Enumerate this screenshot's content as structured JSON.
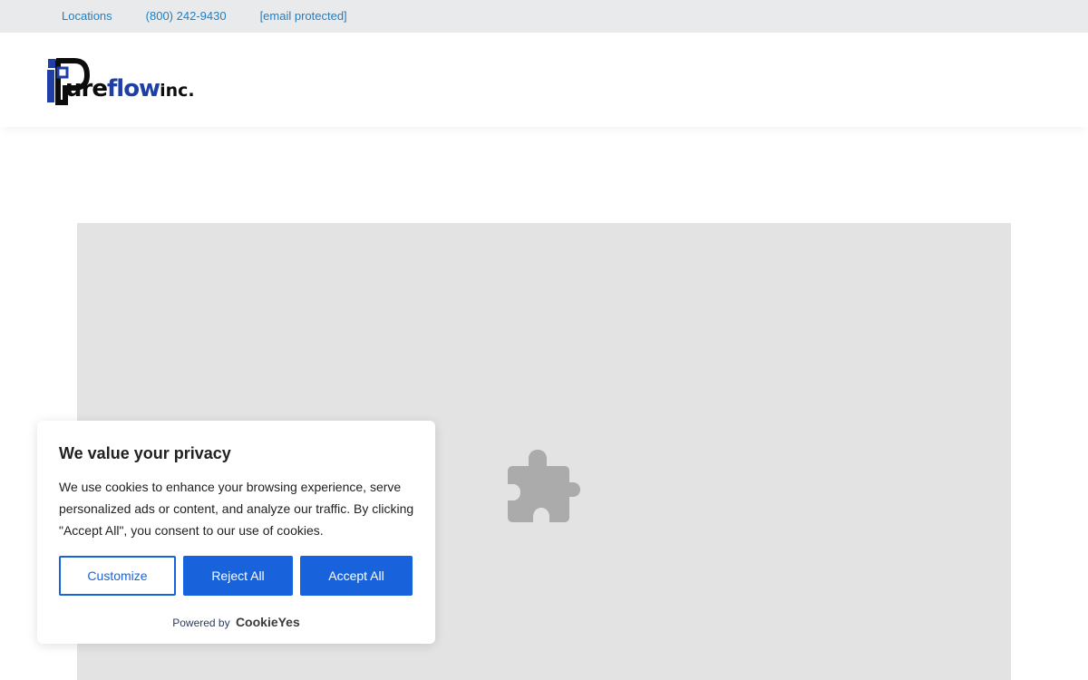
{
  "topbar": {
    "links": [
      "Locations",
      "(800) 242-9430",
      "[email protected]"
    ]
  },
  "logo": {
    "part1": "ure",
    "part2": "flow",
    "part3": "inc."
  },
  "embed": {
    "icon": "puzzle-icon"
  },
  "cookie_banner": {
    "title": "We value your privacy",
    "body": "We use cookies to enhance your browsing experience, serve personalized ads or content, and analyze our traffic. By clicking \"Accept All\", you consent to our use of cookies.",
    "customize_label": "Customize",
    "reject_label": "Reject All",
    "accept_label": "Accept All",
    "powered_by": "Powered by",
    "brand": "CookieYes"
  },
  "colors": {
    "accent": "#1863dc",
    "link": "#1f7fc4",
    "topbar_bg": "#e9eaeb",
    "embed_bg": "#e3e3e3",
    "logo_blue": "#1f3fa6"
  }
}
